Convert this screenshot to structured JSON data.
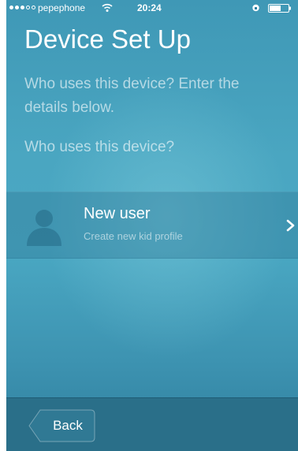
{
  "status_bar": {
    "carrier": "pepephone",
    "time": "20:24",
    "signal_bars_filled": 3,
    "signal_bars_total": 5,
    "icons": [
      "signal-dots",
      "wifi-icon",
      "lock-icon",
      "battery-icon"
    ]
  },
  "header": {
    "title": "Device Set Up",
    "instruction": "Who uses this device? Enter the details below.",
    "question": "Who uses this device?"
  },
  "user_row": {
    "name": "New user",
    "subtitle": "Create new kid profile",
    "avatar_icon": "person-silhouette-icon",
    "chevron_icon": "chevron-right-icon"
  },
  "footer": {
    "back_label": "Back"
  },
  "colors": {
    "background_top": "#3f98b6",
    "background_bottom": "#2f7f9e",
    "footer_bar": "#2a6f89",
    "text": "#ffffff"
  }
}
